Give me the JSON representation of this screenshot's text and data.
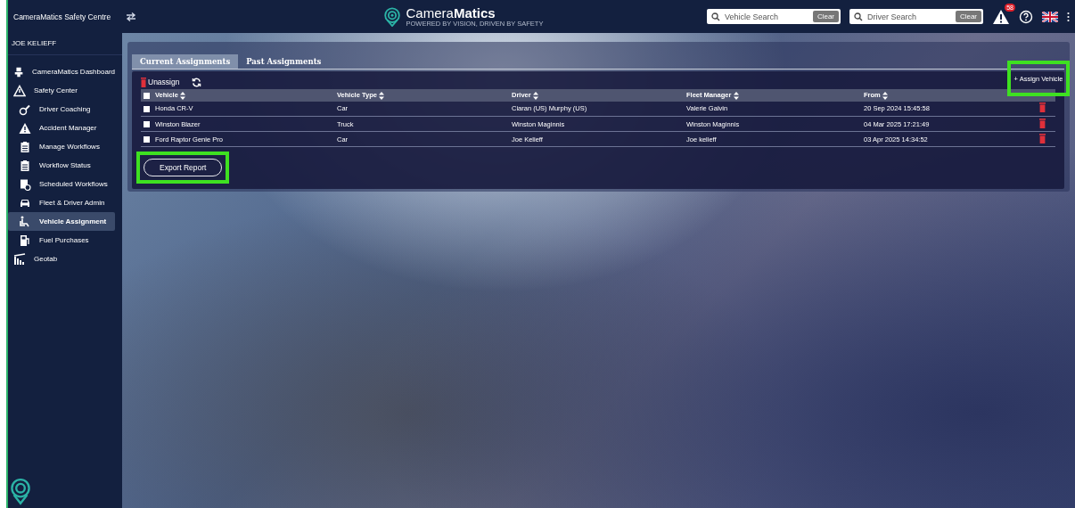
{
  "topbar": {
    "app_title": "CameraMatics Safety Centre",
    "logo_text": {
      "light": "Camera",
      "bold": "Matics"
    },
    "logo_tagline": "POWERED BY VISION, DRIVEN BY SAFETY",
    "searches": [
      {
        "placeholder": "Vehicle Search",
        "button": "Clear"
      },
      {
        "placeholder": "Driver Search",
        "button": "Clear"
      }
    ],
    "alert_badge": "58"
  },
  "sidebar": {
    "user": "JOE KELIEFF",
    "items": [
      {
        "label": "CameraMatics Dashboard",
        "selected": false
      },
      {
        "label": "Safety Center",
        "selected": false,
        "children": [
          {
            "label": "Driver Coaching",
            "selected": false
          },
          {
            "label": "Accident Manager",
            "selected": false
          },
          {
            "label": "Manage Workflows",
            "selected": false
          },
          {
            "label": "Workflow Status",
            "selected": false
          },
          {
            "label": "Scheduled Workflows",
            "selected": false
          },
          {
            "label": "Fleet & Driver Admin",
            "selected": false
          },
          {
            "label": "Vehicle Assignment",
            "selected": true
          },
          {
            "label": "Fuel Purchases",
            "selected": false
          }
        ]
      },
      {
        "label": "Geotab",
        "selected": false
      }
    ]
  },
  "tabs": [
    {
      "label": "Current Assignments",
      "selected": true
    },
    {
      "label": "Past Assignments",
      "selected": false
    }
  ],
  "toolbar": {
    "unassign": "Unassign",
    "assign": "+ Assign Vehicle"
  },
  "table": {
    "all_checked": false,
    "columns": [
      "Vehicle",
      "Vehicle Type",
      "Driver",
      "Fleet Manager",
      "From"
    ],
    "rows": [
      {
        "checked": false,
        "cells": [
          "Honda CR-V",
          "Car",
          "Ciaran (US) Murphy (US)",
          "Valerie Galvin",
          "20 Sep 2024 15:45:58"
        ]
      },
      {
        "checked": false,
        "cells": [
          "Winston Blazer",
          "Truck",
          "Winston Maginnis",
          "Winston Maginnis",
          "04 Mar 2025 17:21:49"
        ]
      },
      {
        "checked": false,
        "cells": [
          "Ford Raptor Genie Pro",
          "Car",
          "Joe Kelieff",
          "Joe kelieff",
          "03 Apr 2025 14:34:52"
        ]
      }
    ]
  },
  "export_button": "Export Report"
}
